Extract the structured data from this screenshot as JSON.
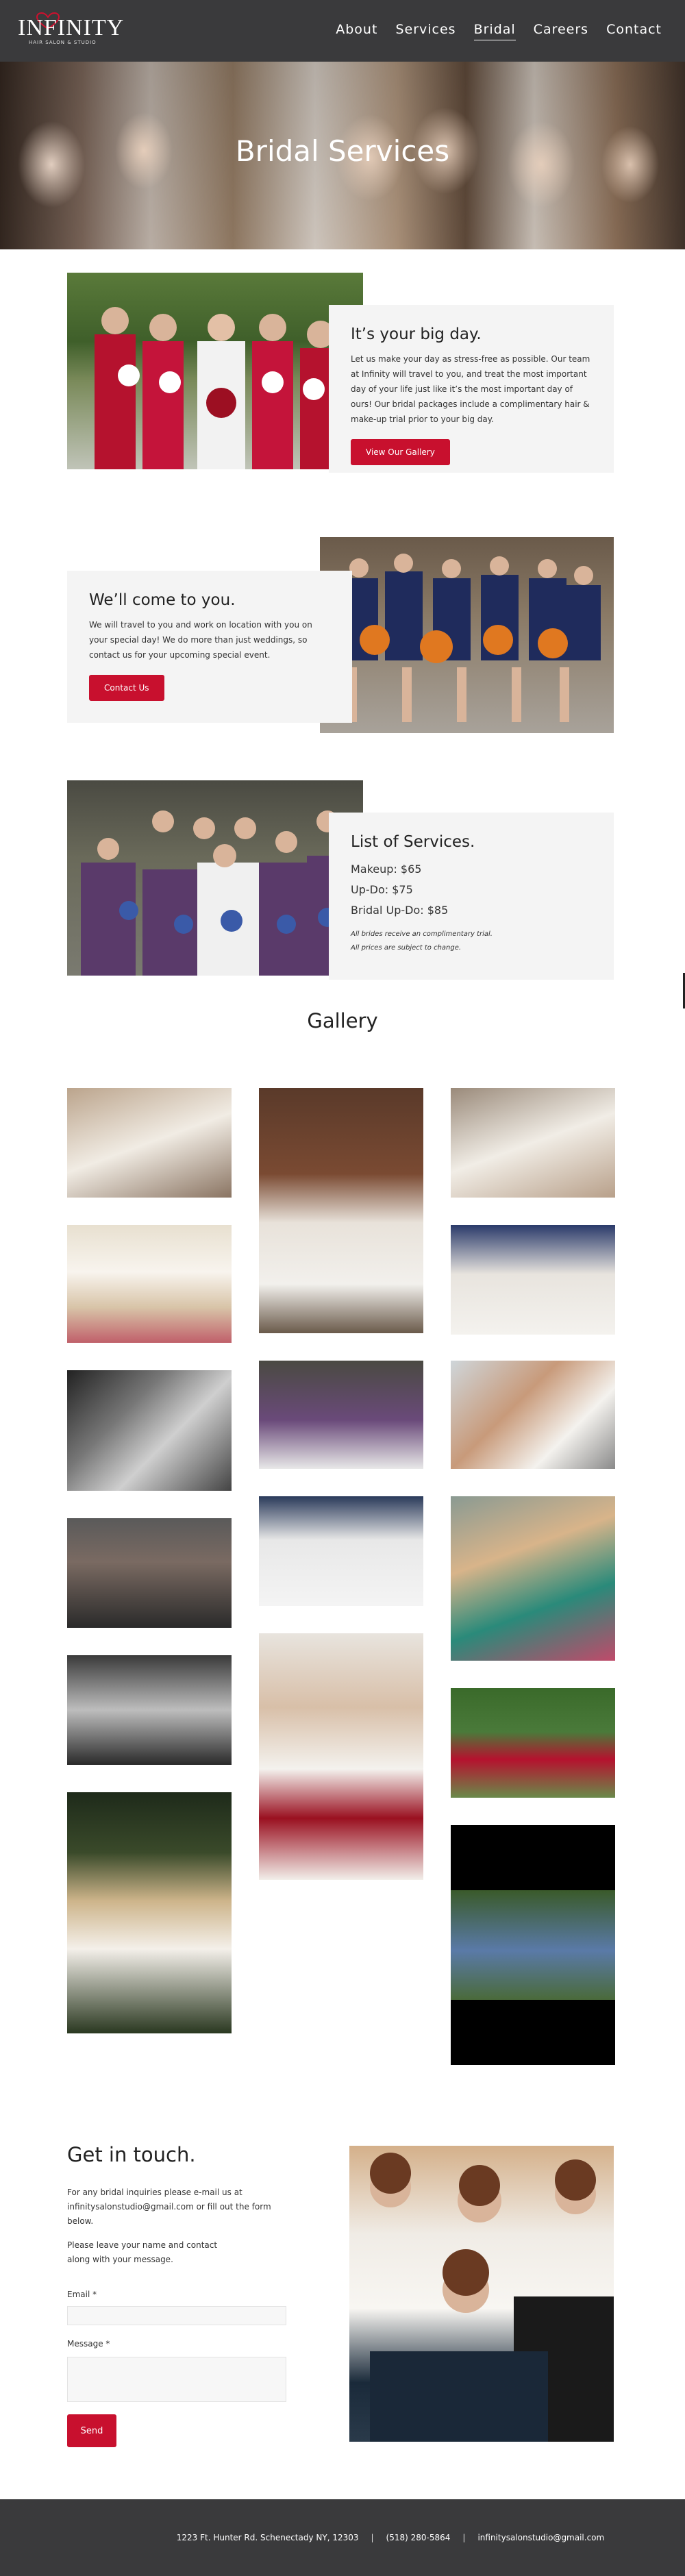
{
  "nav": {
    "logo_text": "INFINITY",
    "logo_sub": "HAIR SALON & STUDIO",
    "items": [
      {
        "label": "About"
      },
      {
        "label": "Services"
      },
      {
        "label": "Bridal",
        "active": true
      },
      {
        "label": "Careers"
      },
      {
        "label": "Contact"
      }
    ]
  },
  "hero": {
    "title": "Bridal Services"
  },
  "big_day": {
    "title": "It’s your big day.",
    "text": "Let us make your day as stress-free as possible. Our team at Infinity will travel to you, and treat the most important day of your life just like it’s the most important day of ours! Our bridal packages include a complimentary hair & make-up trial prior to your big day.",
    "button": "View Our Gallery"
  },
  "come_to_you": {
    "title": "We’ll come to you.",
    "text": "We will travel to you and work on location with you on your special day! We do more than just weddings, so contact us for your upcoming special event.",
    "button": "Contact Us"
  },
  "services": {
    "title": "List of Services.",
    "items": [
      "Makeup: $65",
      "Up-Do: $75",
      "Bridal Up-Do: $85"
    ],
    "notes": [
      "All brides receive an complimentary trial.",
      "All prices are subject to change."
    ]
  },
  "gallery": {
    "title": "Gallery"
  },
  "contact": {
    "title": "Get in touch.",
    "text1": "For any bridal inquiries please e-mail us at infinitysalonstudio@gmail.com or fill out the form below.",
    "text2": "Please leave your name and contact along with your message.",
    "email_label": "Email *",
    "message_label": "Message *",
    "email_value": "",
    "message_value": "",
    "send": "Send"
  },
  "footer": {
    "address": "1223 Ft. Hunter Rd. Schenectady NY, 12303",
    "separator": "|",
    "phone": "(518) 280-5864",
    "email": "infinitysalonstudio@gmail.com"
  },
  "colors": {
    "accent": "#c8102e",
    "nav_bg": "#3a3a3c",
    "card_bg": "#f4f4f4"
  }
}
